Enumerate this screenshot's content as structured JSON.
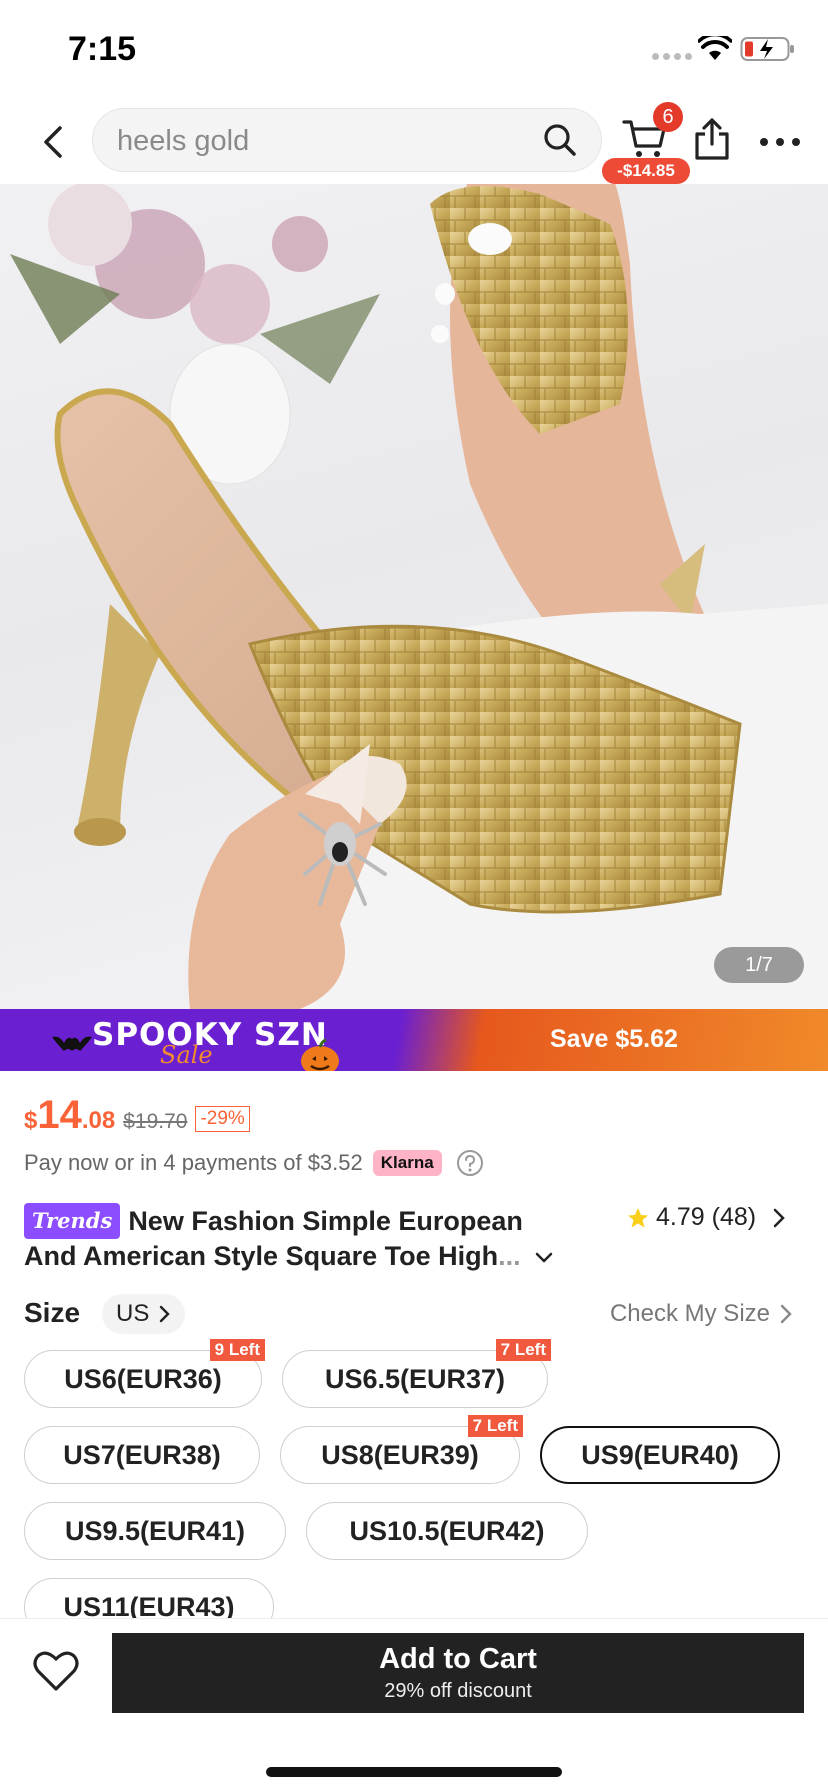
{
  "status": {
    "time": "7:15"
  },
  "nav": {
    "search_text": "heels gold",
    "cart_count": "6",
    "cart_discount": "-$14.85"
  },
  "gallery": {
    "counter": "1/7"
  },
  "promo": {
    "title": "SPOOKY SZN",
    "subtitle": "Sale",
    "save": "Save $5.62"
  },
  "price": {
    "currency": "$",
    "main": "14",
    "cents": ".08",
    "original": "$19.70",
    "discount": "-29%"
  },
  "installment": {
    "text": "Pay now or in 4 payments of $3.52",
    "provider": "Klarna"
  },
  "product": {
    "tag": "Trends",
    "title_line1": "New Fashion Simple European",
    "title_line2": "And American Style Square Toe High",
    "title_fade": "...",
    "rating": "4.79",
    "review_count": "(48)"
  },
  "size": {
    "label": "Size",
    "unit": "US",
    "check": "Check My Size",
    "options": [
      {
        "label": "US6(EUR36)",
        "badge": "9 Left"
      },
      {
        "label": "US6.5(EUR37)",
        "badge": "7 Left"
      },
      {
        "label": "US7(EUR38)",
        "badge": ""
      },
      {
        "label": "US8(EUR39)",
        "badge": "7 Left"
      },
      {
        "label": "US9(EUR40)",
        "badge": "",
        "selected": true
      },
      {
        "label": "US9.5(EUR41)",
        "badge": ""
      },
      {
        "label": "US10.5(EUR42)",
        "badge": ""
      },
      {
        "label": "US11(EUR43)",
        "badge": ""
      }
    ]
  },
  "cart_button": {
    "label": "Add to Cart",
    "sub": "29% off discount"
  },
  "colors": {
    "accent": "#fa6338",
    "promo_purple": "#6a1fd1",
    "promo_orange": "#f08a2a",
    "button_dark": "#222222"
  }
}
